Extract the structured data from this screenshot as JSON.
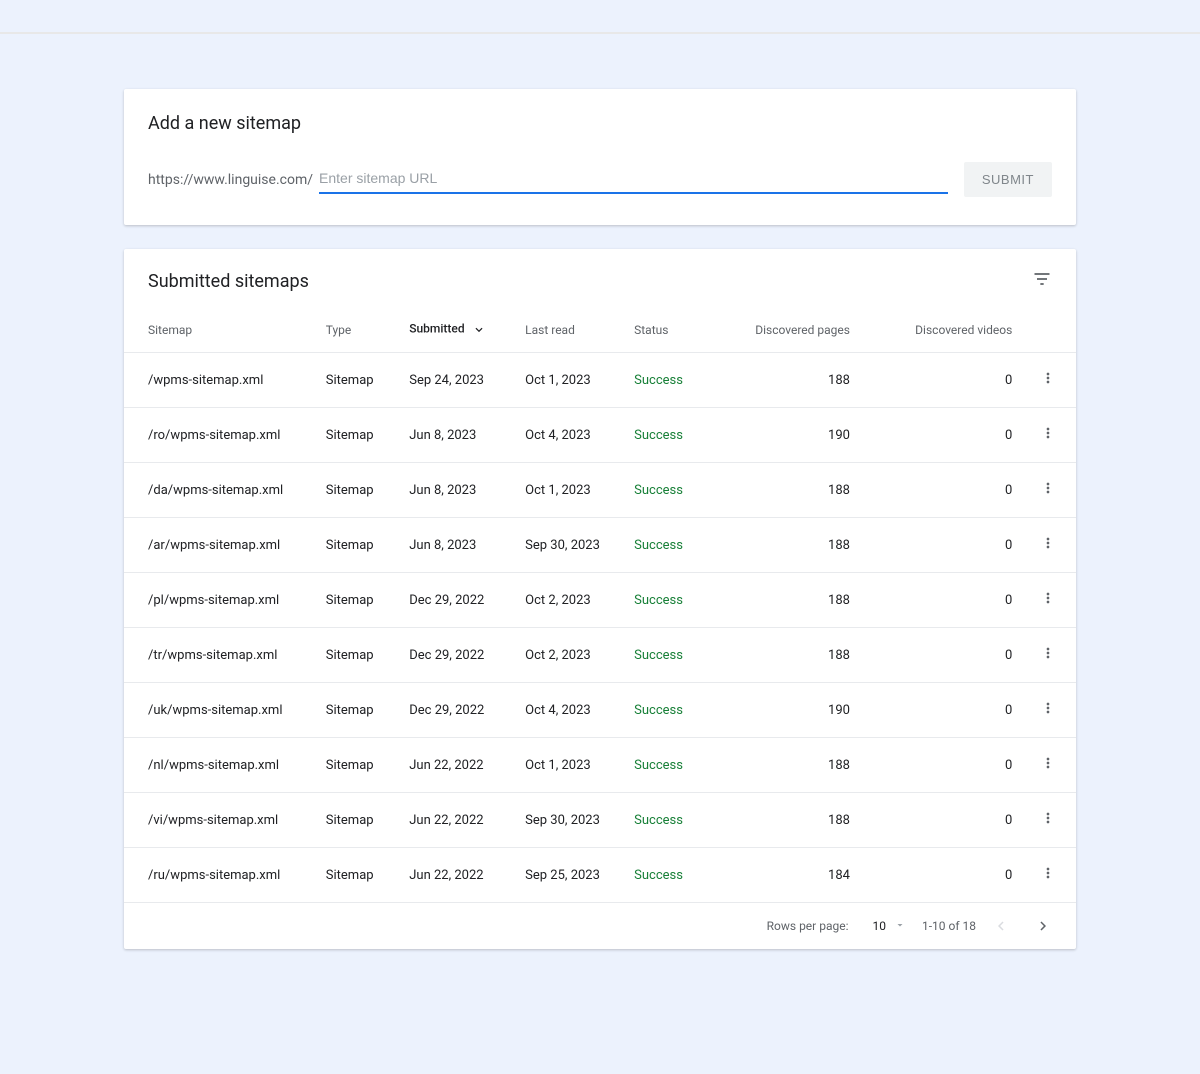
{
  "addSitemap": {
    "title": "Add a new sitemap",
    "urlPrefix": "https://www.linguise.com/",
    "placeholder": "Enter sitemap URL",
    "submitLabel": "SUBMIT"
  },
  "listTitle": "Submitted sitemaps",
  "columns": {
    "sitemap": "Sitemap",
    "type": "Type",
    "submitted": "Submitted",
    "lastRead": "Last read",
    "status": "Status",
    "pages": "Discovered pages",
    "videos": "Discovered videos"
  },
  "rows": [
    {
      "sitemap": "/wpms-sitemap.xml",
      "type": "Sitemap",
      "submitted": "Sep 24, 2023",
      "lastRead": "Oct 1, 2023",
      "status": "Success",
      "pages": "188",
      "videos": "0"
    },
    {
      "sitemap": "/ro/wpms-sitemap.xml",
      "type": "Sitemap",
      "submitted": "Jun 8, 2023",
      "lastRead": "Oct 4, 2023",
      "status": "Success",
      "pages": "190",
      "videos": "0"
    },
    {
      "sitemap": "/da/wpms-sitemap.xml",
      "type": "Sitemap",
      "submitted": "Jun 8, 2023",
      "lastRead": "Oct 1, 2023",
      "status": "Success",
      "pages": "188",
      "videos": "0"
    },
    {
      "sitemap": "/ar/wpms-sitemap.xml",
      "type": "Sitemap",
      "submitted": "Jun 8, 2023",
      "lastRead": "Sep 30, 2023",
      "status": "Success",
      "pages": "188",
      "videos": "0"
    },
    {
      "sitemap": "/pl/wpms-sitemap.xml",
      "type": "Sitemap",
      "submitted": "Dec 29, 2022",
      "lastRead": "Oct 2, 2023",
      "status": "Success",
      "pages": "188",
      "videos": "0"
    },
    {
      "sitemap": "/tr/wpms-sitemap.xml",
      "type": "Sitemap",
      "submitted": "Dec 29, 2022",
      "lastRead": "Oct 2, 2023",
      "status": "Success",
      "pages": "188",
      "videos": "0"
    },
    {
      "sitemap": "/uk/wpms-sitemap.xml",
      "type": "Sitemap",
      "submitted": "Dec 29, 2022",
      "lastRead": "Oct 4, 2023",
      "status": "Success",
      "pages": "190",
      "videos": "0"
    },
    {
      "sitemap": "/nl/wpms-sitemap.xml",
      "type": "Sitemap",
      "submitted": "Jun 22, 2022",
      "lastRead": "Oct 1, 2023",
      "status": "Success",
      "pages": "188",
      "videos": "0"
    },
    {
      "sitemap": "/vi/wpms-sitemap.xml",
      "type": "Sitemap",
      "submitted": "Jun 22, 2022",
      "lastRead": "Sep 30, 2023",
      "status": "Success",
      "pages": "188",
      "videos": "0"
    },
    {
      "sitemap": "/ru/wpms-sitemap.xml",
      "type": "Sitemap",
      "submitted": "Jun 22, 2022",
      "lastRead": "Sep 25, 2023",
      "status": "Success",
      "pages": "184",
      "videos": "0"
    }
  ],
  "pagination": {
    "rowsLabel": "Rows per page:",
    "rowsValue": "10",
    "rangeText": "1-10 of 18"
  }
}
